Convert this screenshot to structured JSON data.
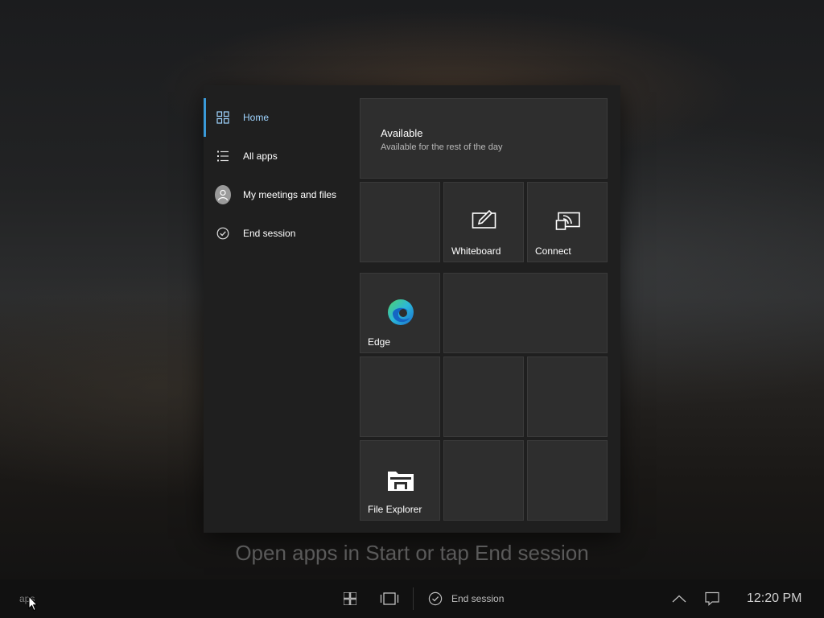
{
  "nav": {
    "items": [
      {
        "label": "Home",
        "icon": "home-grid-icon",
        "active": true
      },
      {
        "label": "All apps",
        "icon": "all-apps-list-icon"
      },
      {
        "label": "My meetings and files",
        "icon": "avatar-icon"
      },
      {
        "label": "End session",
        "icon": "checkmark-circle-icon"
      }
    ]
  },
  "status": {
    "title": "Available",
    "subtitle": "Available for the rest of the day"
  },
  "tiles": {
    "whiteboard": "Whiteboard",
    "connect": "Connect",
    "edge": "Edge",
    "file_explorer": "File Explorer"
  },
  "hint": "Open apps in Start or tap End session",
  "taskbar": {
    "search_text": "aps",
    "end_session": "End session",
    "clock": "12:20 PM"
  },
  "colors": {
    "accent": "#3a9ad9",
    "active_text": "#9fd4ff",
    "panel": "#1f1f1f",
    "tile": "#2e2e2e"
  }
}
